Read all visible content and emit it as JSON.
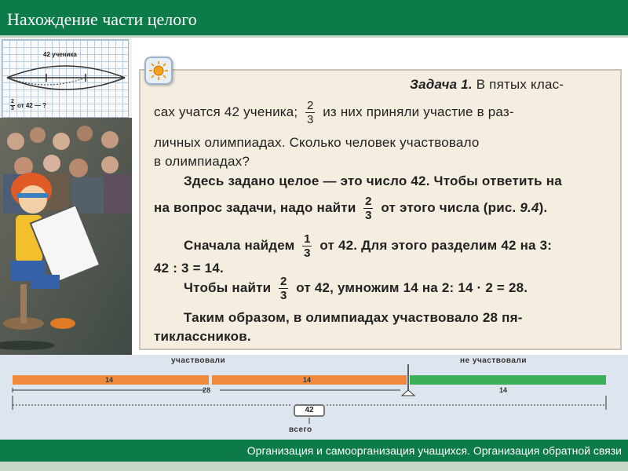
{
  "header": {
    "title": "Нахождение части целого"
  },
  "figure": {
    "top_label": "42 ученика",
    "bottom_frac": {
      "num": "2",
      "den": "3"
    },
    "bottom_text": "от 42 — ?"
  },
  "task": {
    "title": "Задача 1.",
    "line1": "В пятых клас-",
    "line2a": "сах учатся 42 ученика;",
    "frac1": {
      "num": "2",
      "den": "3"
    },
    "line2b": "из них приняли участие в раз-",
    "line3": "личных олимпиадах. Сколько человек участвовало",
    "line4": "в олимпиадах?",
    "line5": "Здесь задано целое — это число 42. Чтобы ответить на",
    "line6a": "на вопрос задачи, надо найти",
    "frac2": {
      "num": "2",
      "den": "3"
    },
    "line6b": "от этого числа (рис.",
    "line6ref": "9.4",
    "line6c": ").",
    "line7a": "Сначала найдем",
    "frac3": {
      "num": "1",
      "den": "3"
    },
    "line7b": "от 42. Для этого разделим 42 на 3:",
    "line8": "42 : 3 = 14.",
    "line9a": "Чтобы найти",
    "frac4": {
      "num": "2",
      "den": "3"
    },
    "line9b": "от 42, умножим 14 на 2: 14 · 2 = 28.",
    "line10": "Таким образом, в олимпиадах участвовало 28 пя-",
    "line11": "тиклассников."
  },
  "diagram": {
    "label_participated": "участвовали",
    "label_not_participated": "не участвовали",
    "seg1_value": "14",
    "seg2_value": "14",
    "sum_value": "28",
    "rest_value": "14",
    "total_value": "42",
    "total_label": "всего",
    "color_participated": "#f08a3e",
    "color_not_participated": "#3fae5a"
  },
  "footer": {
    "text": "Организация и самоорганизация учащихся. Организация обратной связи"
  }
}
